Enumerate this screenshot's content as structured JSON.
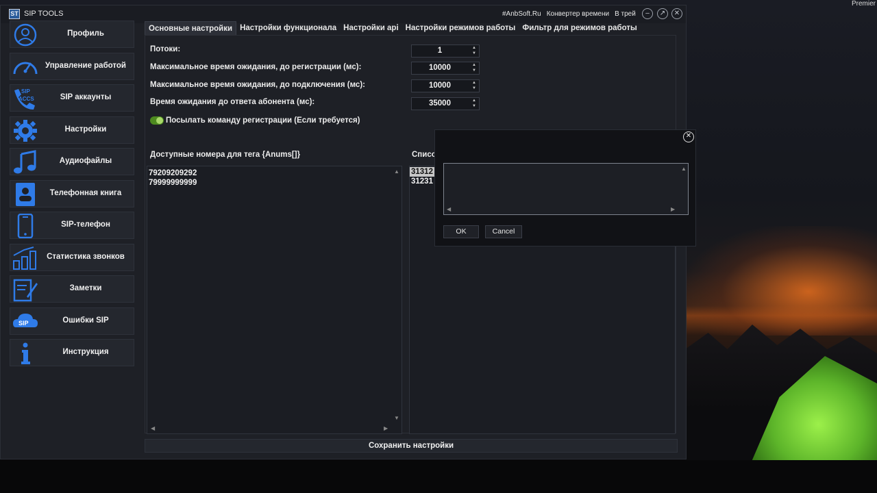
{
  "desktop": {
    "corner_text": "Premier"
  },
  "window": {
    "title": "SIP TOOLS",
    "logo_text": "ST",
    "links": [
      "#AnbSoft.Ru",
      "Конвертер времени",
      "В трей"
    ]
  },
  "sidebar": {
    "items": [
      {
        "label": "Профиль",
        "icon": "profile-icon"
      },
      {
        "label": "Управление работой",
        "icon": "speedometer-icon"
      },
      {
        "label": "SIP аккаунты",
        "icon": "sip-accounts-icon",
        "icon_text": "SIP ACCS"
      },
      {
        "label": "Настройки",
        "icon": "gear-icon"
      },
      {
        "label": "Аудиофайлы",
        "icon": "music-note-icon"
      },
      {
        "label": "Телефонная книга",
        "icon": "phonebook-icon"
      },
      {
        "label": "SIP-телефон",
        "icon": "mobile-phone-icon"
      },
      {
        "label": "Статистика звонков",
        "icon": "bar-chart-icon"
      },
      {
        "label": "Заметки",
        "icon": "notes-icon"
      },
      {
        "label": "Ошибки SIP",
        "icon": "sip-error-icon",
        "icon_text": "SIP"
      },
      {
        "label": "Инструкция",
        "icon": "info-icon"
      }
    ]
  },
  "tabs": [
    {
      "label": "Основные настройки",
      "active": true
    },
    {
      "label": "Настройки функционала",
      "active": false
    },
    {
      "label": "Настройки api",
      "active": false
    },
    {
      "label": "Настройки режимов работы",
      "active": false
    },
    {
      "label": "Фильтр для режимов работы",
      "active": false
    }
  ],
  "settings": {
    "threads": {
      "label": "Потоки:",
      "value": "1"
    },
    "reg_timeout": {
      "label": "Максимальное время ожидания, до регистрации (мс):",
      "value": "10000"
    },
    "conn_timeout": {
      "label": "Максимальное время ожидания, до подключения (мс):",
      "value": "10000"
    },
    "answer_timeout": {
      "label": "Время ожидания до ответа абонента (мс):",
      "value": "35000"
    },
    "send_register": {
      "label": "Посылать команду регистрации (Если требуется)",
      "enabled": true
    }
  },
  "numbers_list": {
    "label": "Доступные номера для тега {Anums[]}",
    "items": [
      "79209209292",
      "79999999999"
    ]
  },
  "second_list": {
    "label": "Списо",
    "items": [
      "31312",
      "31231"
    ]
  },
  "save_button": "Сохранить настройки",
  "dialog": {
    "input_value": "",
    "ok_label": "OK",
    "cancel_label": "Cancel"
  },
  "colors": {
    "accent_blue": "#2f7be8",
    "toggle_green": "#4d8a1f",
    "window_bg": "#1e2026"
  }
}
